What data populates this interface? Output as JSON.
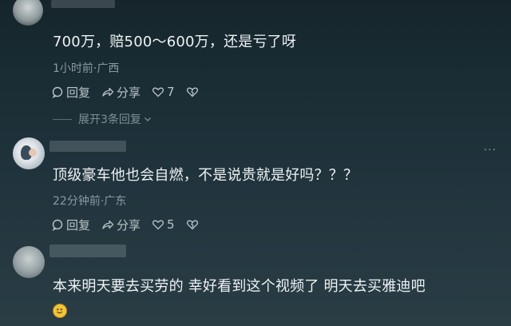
{
  "comments": [
    {
      "text": "700万，赔500～600万，还是亏了呀",
      "meta": "1小时前·广西",
      "reply_label": "回复",
      "share_label": "分享",
      "like_count": "7",
      "expand_label": "展开3条回复"
    },
    {
      "text": "顶级豪车他也会自燃，不是说贵就是好吗？？？",
      "meta": "22分钟前·广东",
      "reply_label": "回复",
      "share_label": "分享",
      "like_count": "5",
      "more_label": "···"
    },
    {
      "text": "本来明天要去买劳的 幸好看到这个视频了  明天去买雅迪吧",
      "emoji": "smiling-emoji"
    }
  ],
  "icons": {
    "reply": "reply-bubble-icon",
    "share": "share-arrow-icon",
    "like": "heart-icon",
    "dislike": "broken-heart-icon",
    "expand": "chevron-down-icon"
  }
}
